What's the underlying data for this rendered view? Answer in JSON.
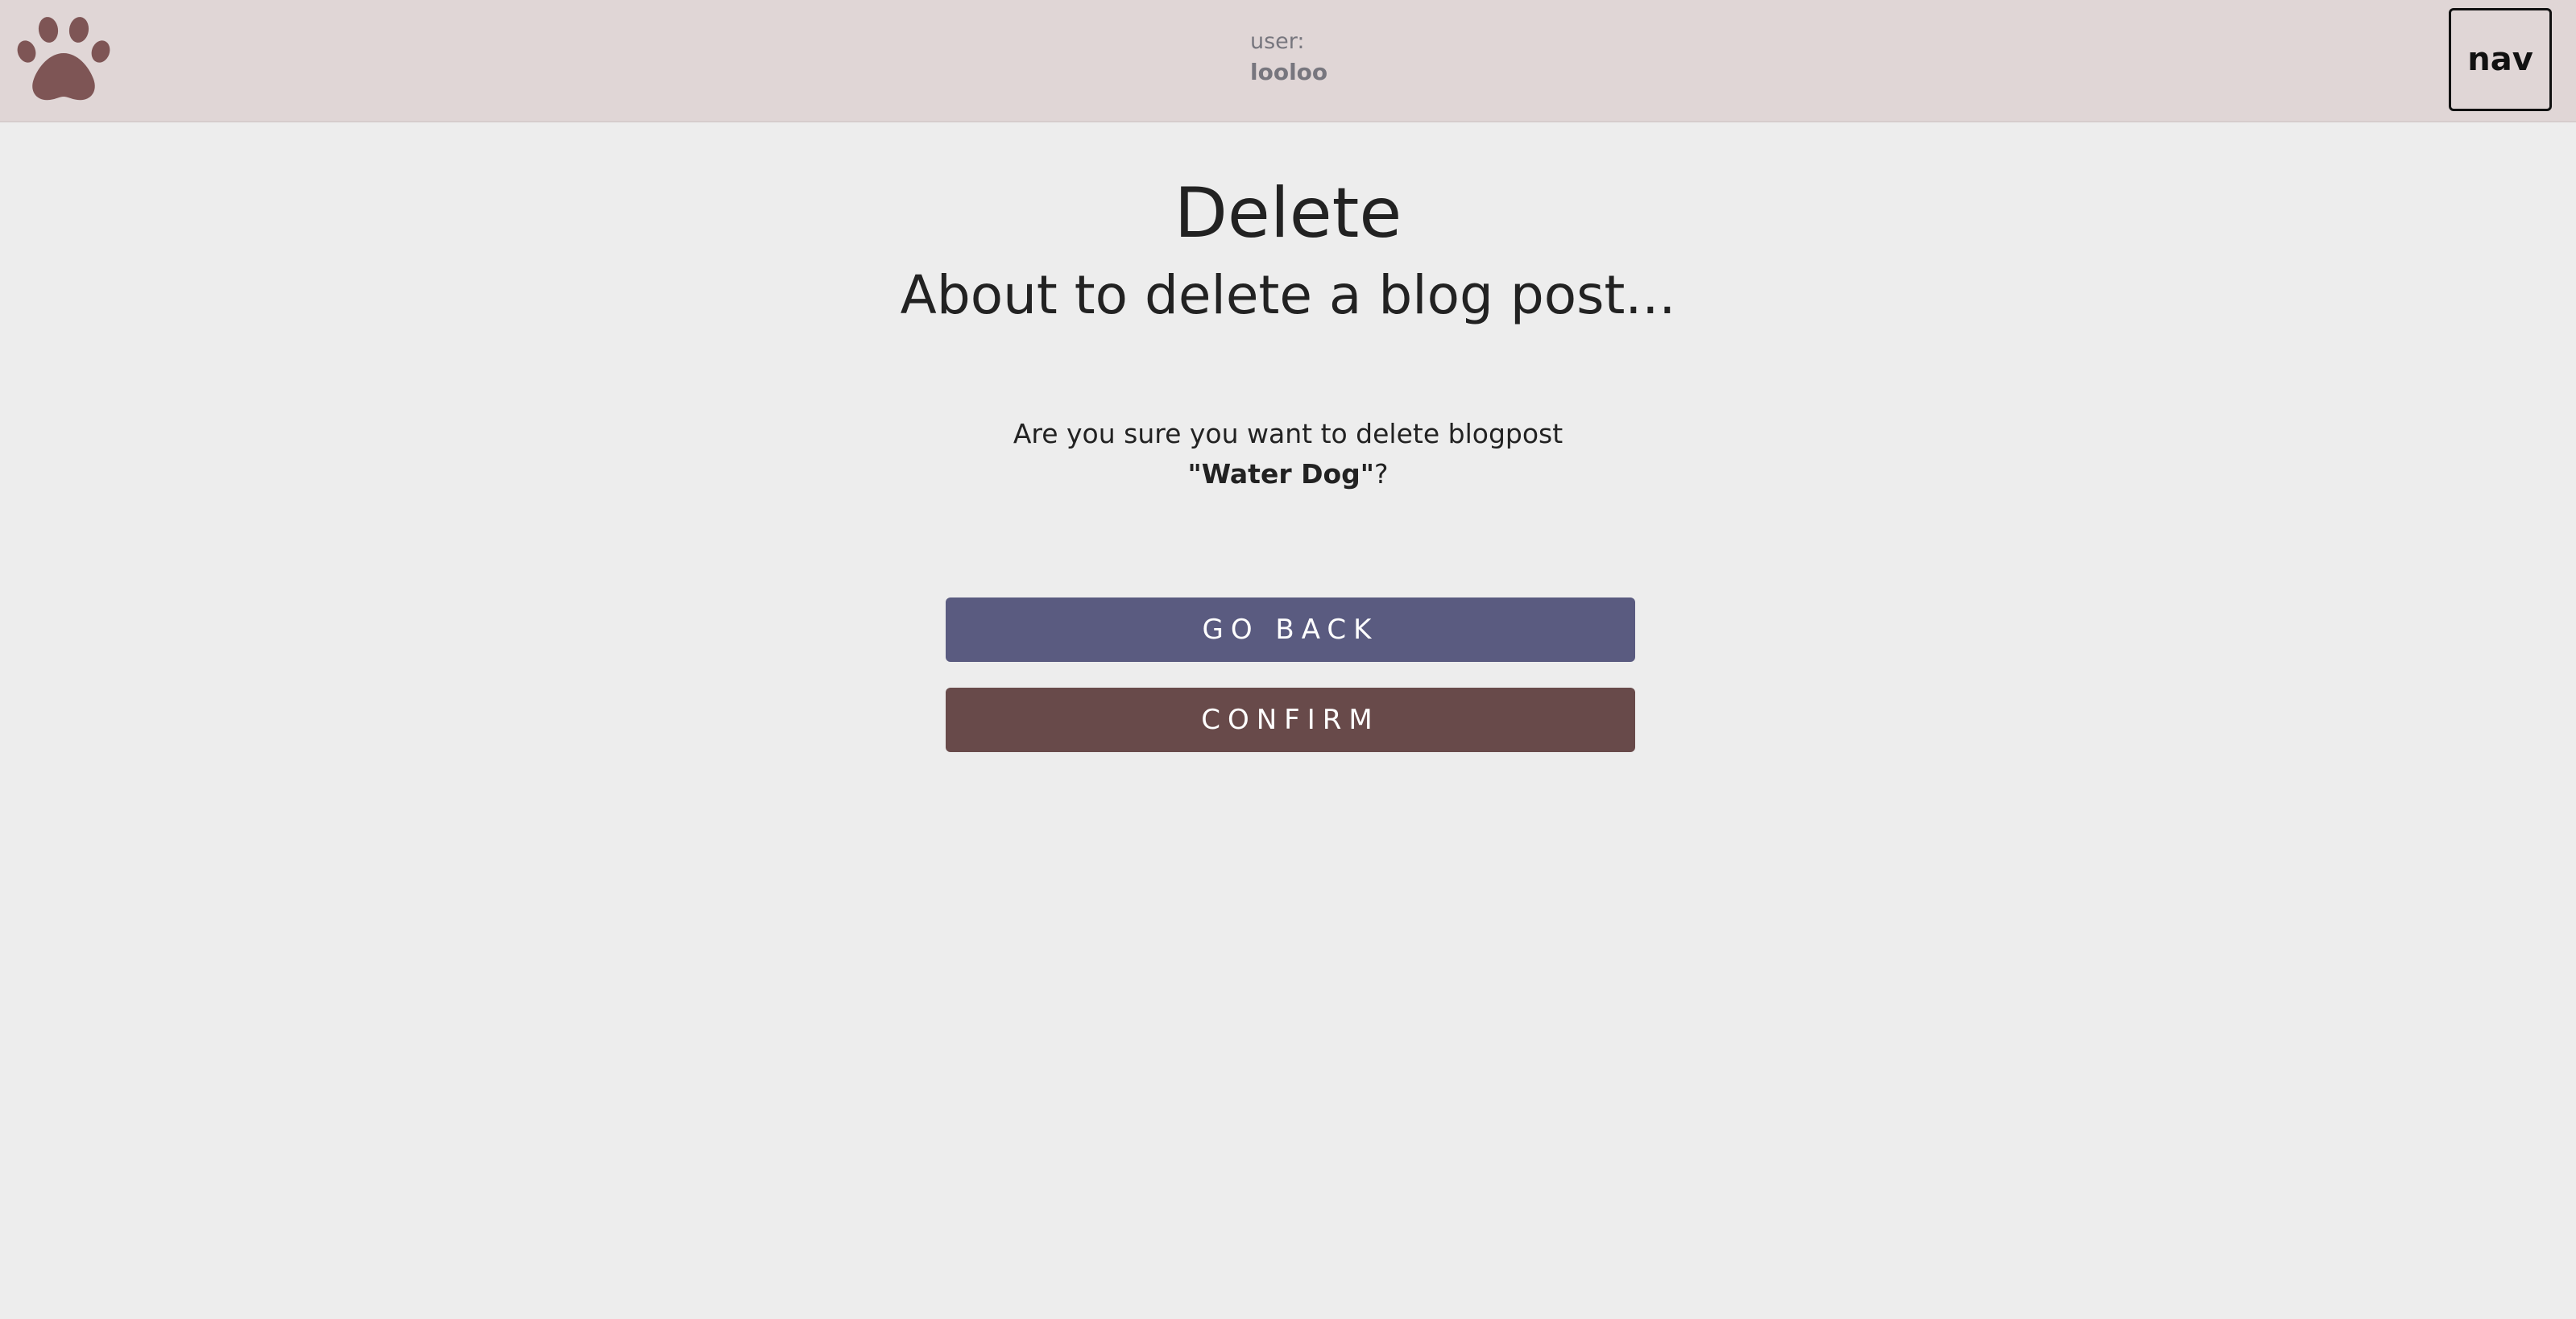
{
  "header": {
    "logo_icon": "paw-icon",
    "user_label": "user:",
    "user_name": "looloo",
    "nav_label": "nav"
  },
  "main": {
    "title": "Delete",
    "subtitle": "About to delete a blog post...",
    "prompt_text": "Are you sure you want to delete blogpost",
    "post_title": "\"Water Dog\"",
    "prompt_end": "?",
    "go_back_label": "GO BACK",
    "confirm_label": "CONFIRM"
  },
  "colors": {
    "header_bg": "#e0d6d6",
    "page_bg": "#ededed",
    "paw": "#7e5555",
    "go_back_bg": "#5a5b80",
    "confirm_bg": "#684a4a"
  }
}
